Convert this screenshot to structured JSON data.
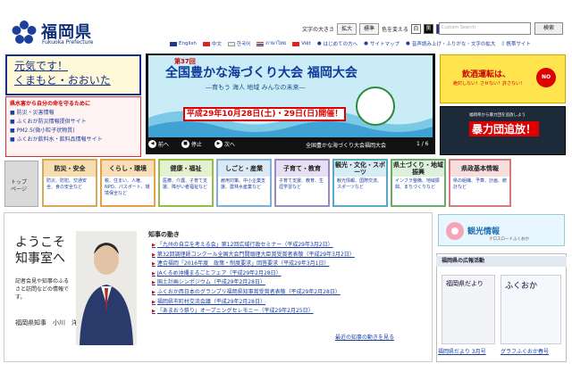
{
  "header": {
    "site_name": "福岡県",
    "site_sub": "Fukuoka Prefecture",
    "font_size_label": "文字の大きさ",
    "enlarge": "拡大",
    "standard": "標準",
    "color_change_label": "色を変える",
    "color_white": "白",
    "color_black": "黒",
    "color_blue": "青",
    "search_placeholder": "Custom Search",
    "search_button": "検索",
    "languages": [
      "English",
      "中文",
      "한국어",
      "ภาษาไทย",
      "Việt"
    ],
    "links": [
      "はじめての方へ",
      "サイトマップ",
      "音声読み上げ・ふりがな・文字の拡大",
      "携帯サイト"
    ]
  },
  "promo": {
    "genki_line1": "元気です！",
    "genki_line2": "くまもと・おおいた",
    "notice_head": "県水害から自分の命を守るために",
    "notices": [
      "防災・災害情報",
      "ふくおか防災情報提供サイト",
      "PM2.5(微小粒子状物質)",
      "ふくおか飲料水・飲料品情報サイト"
    ]
  },
  "carousel": {
    "badge": "第37回",
    "title": "全国豊かな海づくり大会 福岡大会",
    "subtitle": "―育もう 海人 地域 みんなの未来―",
    "date": "平成29年10月28日(土)・29日(日)開催！",
    "prev": "前へ",
    "stop": "停止",
    "next": "次へ",
    "caption": "全国豊かな海づくり大会福岡大会",
    "count": "1 / 6"
  },
  "right_banners": {
    "drink_title": "飲酒運転は、",
    "drink_sub": "絶対しない！させない！許さない！",
    "drink_badge": "NO",
    "gang_sub": "福岡県から暴力団を追放しよう",
    "gang_title": "暴力団追放！"
  },
  "nav": {
    "top_label_1": "トップ",
    "top_label_2": "ページ",
    "categories": [
      {
        "title": "防災・安全",
        "body": "防災、防犯、交通安全、食の安全など"
      },
      {
        "title": "くらし・環境",
        "body": "税、住まい、人権、NPO、パスポート、環境保全など"
      },
      {
        "title": "健康・福祉",
        "body": "医療、介護、子育て支援、障がい者福祉など"
      },
      {
        "title": "しごと・産業",
        "body": "雇用対策、中小企業支援、農林水産業など"
      },
      {
        "title": "子育て・教育",
        "body": "子育て支援、教育、生涯学習など"
      },
      {
        "title": "観光・文化・スポーツ",
        "body": "観光情報、国際交流、スポーツなど"
      },
      {
        "title": "県土づくり・地域振興",
        "body": "インフラ整備、地域振興、まちづくりなど"
      },
      {
        "title": "県政基本情報",
        "body": "県の組織、予算、計画、統計など"
      }
    ]
  },
  "governor": {
    "welcome_1": "ようこそ",
    "welcome_2": "知事室へ",
    "note": "記者会見や知事のふるさと訪問などの情報です。",
    "sign": "福岡県知事　小川　洋"
  },
  "news": {
    "heading": "知事の動き",
    "items": [
      "「九州の自立を考える会」第12回広域行政セミナー（平成29年3月2日）",
      "第32回調理師コンクール全国大会門間頭理大臣賞受賞者表敬（平成29年3月2日）",
      "連合福岡「2016年度　政策・制度要求」回答要求（平成29年3月1日）",
      "JAくるめ沖縄まるごとフェア（平成29年2月28日）",
      "国土計画シンポジウム（平成29年2月28日）",
      "ふくおか西日本のグランプリ福岡県知事賞受賞者表敬（平成29年2月28日）",
      "福岡県市町村交流会議（平成29年2月28日）",
      "「あまおう祭り」オープニングセレモニー（平成29年2月25日）"
    ],
    "more": "最近の知事の動きを見る"
  },
  "side": {
    "kanko_title": "観光情報",
    "kanko_sub": "クロスロードふくおか",
    "koho_heading": "福岡県の広報活動",
    "mag1_cover": "福岡県だより",
    "mag2_cover": "ふくおか",
    "mag1_label": "福岡県だより 3月号",
    "mag2_label": "グラフふくおか春号"
  }
}
